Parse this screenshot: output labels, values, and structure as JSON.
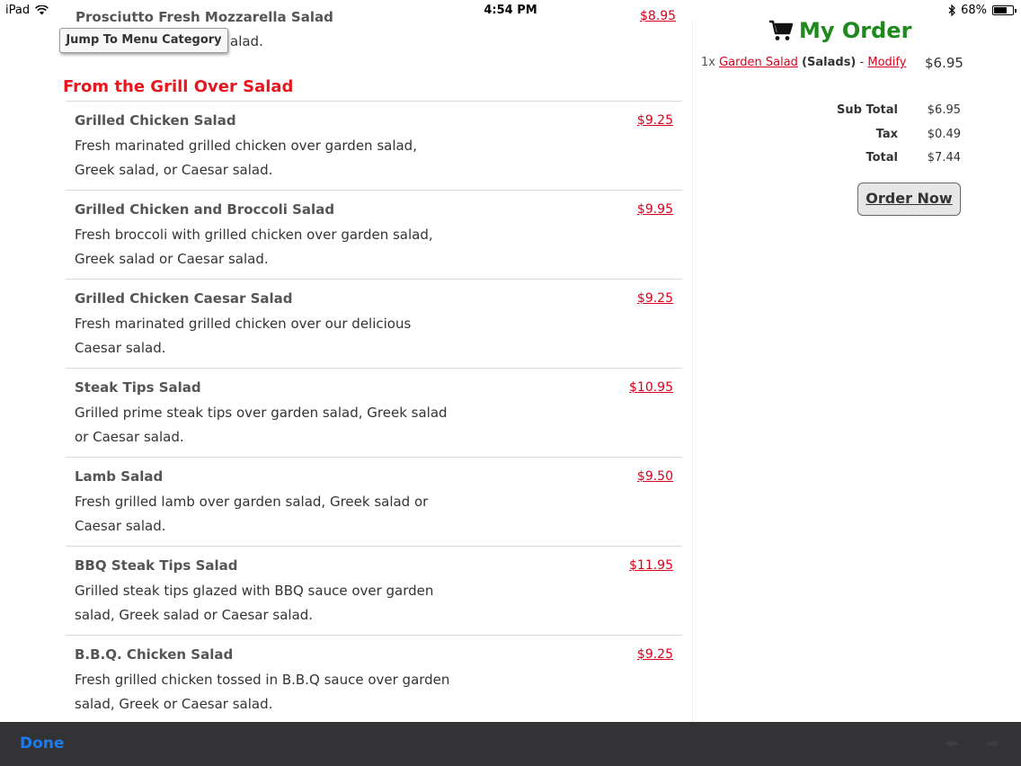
{
  "status_bar": {
    "device": "iPad",
    "time": "4:54 PM",
    "battery_percent": "68%",
    "battery_level": 0.68
  },
  "menu": {
    "previous_item": {
      "name": "Prosciutto Fresh Mozzarella Salad",
      "price": "$8.95",
      "desc_visible": "alad."
    },
    "jump_button": "Jump To Menu Category",
    "category_title": "From the Grill Over Salad",
    "items": [
      {
        "name": "Grilled Chicken Salad",
        "price": "$9.25",
        "desc": "Fresh marinated grilled chicken over garden salad, Greek salad, or Caesar salad."
      },
      {
        "name": "Grilled Chicken and Broccoli Salad",
        "price": "$9.95",
        "desc": "Fresh broccoli with grilled chicken over garden salad, Greek salad or Caesar salad."
      },
      {
        "name": "Grilled Chicken Caesar Salad",
        "price": "$9.25",
        "desc": "Fresh marinated grilled chicken over our delicious Caesar salad."
      },
      {
        "name": "Steak Tips Salad",
        "price": "$10.95",
        "desc": "Grilled prime steak tips over garden salad, Greek salad or Caesar salad."
      },
      {
        "name": "Lamb Salad",
        "price": "$9.50",
        "desc": "Fresh grilled lamb over garden salad, Greek salad or Caesar salad."
      },
      {
        "name": "BBQ Steak Tips Salad",
        "price": "$11.95",
        "desc": "Grilled steak tips glazed with BBQ sauce over garden salad, Greek salad or Caesar salad."
      },
      {
        "name": "B.B.Q. Chicken Salad",
        "price": "$9.25",
        "desc": "Fresh grilled chicken tossed in B.B.Q sauce over garden salad, Greek or Caesar salad."
      }
    ]
  },
  "order": {
    "title": "My Order",
    "line": {
      "qty": "1x",
      "item": "Garden Salad",
      "category": "(Salads)",
      "separator": "-",
      "modify": "Modify",
      "price": "$6.95"
    },
    "totals": {
      "sub_total_label": "Sub Total",
      "sub_total": "$6.95",
      "tax_label": "Tax",
      "tax": "$0.49",
      "total_label": "Total",
      "total": "$7.44"
    },
    "order_button": "Order Now"
  },
  "toolbar": {
    "done": "Done"
  },
  "colors": {
    "accent_red": "#d9001b",
    "category_red": "#e8161e",
    "order_green": "#1e8a1e",
    "toolbar_bg": "#333335",
    "done_blue": "#1a7cf0"
  },
  "icons": [
    "wifi-icon",
    "bluetooth-icon",
    "battery-icon",
    "cart-icon",
    "prev-arrow-icon",
    "next-arrow-icon"
  ]
}
